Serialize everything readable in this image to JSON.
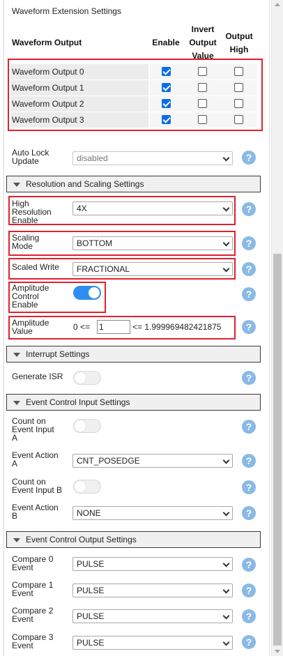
{
  "title": "Waveform Extension Settings",
  "waveform_table": {
    "col_output": "Waveform Output",
    "col_enable": "Enable",
    "col_invert": [
      "Invert",
      "Output",
      "Value"
    ],
    "col_high": [
      "Output",
      "High"
    ],
    "rows": [
      {
        "label": "Waveform Output 0",
        "enable": true,
        "invert": false,
        "high": false
      },
      {
        "label": "Waveform Output 1",
        "enable": true,
        "invert": false,
        "high": false
      },
      {
        "label": "Waveform Output 2",
        "enable": true,
        "invert": false,
        "high": false
      },
      {
        "label": "Waveform Output 3",
        "enable": true,
        "invert": false,
        "high": false
      }
    ]
  },
  "auto_lock": {
    "label": [
      "Auto Lock",
      "Update"
    ],
    "value": "disabled"
  },
  "resolution_section": {
    "title": "Resolution and Scaling Settings",
    "high_res": {
      "label": [
        "High",
        "Resolution",
        "Enable"
      ],
      "value": "4X"
    },
    "scaling_mode": {
      "label": [
        "Scaling",
        "Mode"
      ],
      "value": "BOTTOM"
    },
    "scaled_write": {
      "label": "Scaled Write",
      "value": "FRACTIONAL"
    },
    "amplitude_control": {
      "label": [
        "Amplitude",
        "Control",
        "Enable"
      ],
      "on": true
    },
    "amplitude_value": {
      "label": [
        "Amplitude",
        "Value"
      ],
      "min_text": "0 <=",
      "value": "1",
      "max_text": "<= 1.999969482421875"
    }
  },
  "interrupt_section": {
    "title": "Interrupt Settings",
    "generate_isr": {
      "label": "Generate ISR",
      "on": false
    }
  },
  "event_input_section": {
    "title": "Event Control Input Settings",
    "count_a": {
      "label": [
        "Count on",
        "Event Input",
        "A"
      ],
      "on": false
    },
    "action_a": {
      "label": [
        "Event Action",
        "A"
      ],
      "value": "CNT_POSEDGE"
    },
    "count_b": {
      "label": [
        "Count on",
        "Event Input B"
      ],
      "on": false
    },
    "action_b": {
      "label": [
        "Event Action",
        "B"
      ],
      "value": "NONE"
    }
  },
  "event_output_section": {
    "title": "Event Control Output Settings",
    "compares": [
      {
        "label": [
          "Compare 0",
          "Event"
        ],
        "value": "PULSE"
      },
      {
        "label": [
          "Compare 1",
          "Event"
        ],
        "value": "PULSE"
      },
      {
        "label": [
          "Compare 2",
          "Event"
        ],
        "value": "PULSE"
      },
      {
        "label": [
          "Compare 3",
          "Event"
        ],
        "value": "PULSE"
      }
    ]
  },
  "help_glyph": "?",
  "colors": {
    "highlight": "#e0202e",
    "accent": "#0a6ee8",
    "help": "#8ab9e6"
  }
}
